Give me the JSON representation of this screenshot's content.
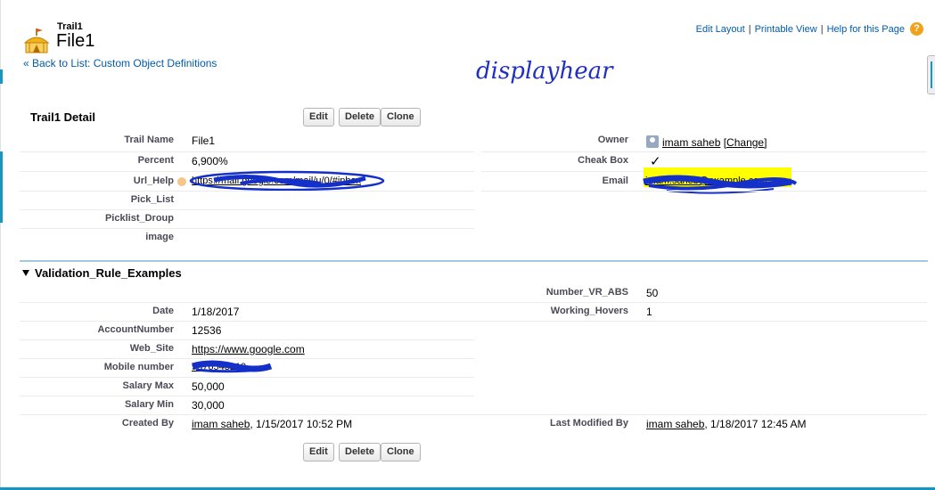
{
  "header": {
    "object_type": "Trail1",
    "record_name": "File1",
    "back_link": "« Back to List: Custom Object Definitions",
    "links": [
      "Edit Layout",
      "Printable View",
      "Help for this Page"
    ],
    "annotation": "displayhear"
  },
  "buttons": {
    "edit": "Edit",
    "delete": "Delete",
    "clone": "Clone"
  },
  "detail": {
    "title": "Trail1 Detail",
    "left": [
      {
        "label": "Trail Name",
        "value": "File1"
      },
      {
        "label": "Percent",
        "value": "6,900%"
      },
      {
        "label": "Url_Help",
        "value": "https://mail.google.com/mail/u/0/#inbox"
      },
      {
        "label": "Pick_List",
        "value": ""
      },
      {
        "label": "Picklist_Droup",
        "value": ""
      },
      {
        "label": "image",
        "value": ""
      }
    ],
    "right": [
      {
        "label": "Owner",
        "value": "imam saheb",
        "extra": "[Change]"
      },
      {
        "label": "Cheak Box",
        "value": "✓"
      },
      {
        "label": "Email",
        "value": "imam.saheb@example.com"
      }
    ]
  },
  "validation": {
    "title": "Validation_Rule_Examples",
    "right": [
      {
        "label": "Number_VR_ABS",
        "value": "50"
      },
      {
        "label": "Working_Hovers",
        "value": "1"
      }
    ],
    "left": [
      {
        "label": "Date",
        "value": "1/18/2017"
      },
      {
        "label": "AccountNumber",
        "value": "12536"
      },
      {
        "label": "Web_Site",
        "value": "https://www.google.com"
      },
      {
        "label": "Mobile number",
        "value": "9876543210"
      },
      {
        "label": "Salary Max",
        "value": "50,000"
      },
      {
        "label": "Salary Min",
        "value": "30,000"
      }
    ],
    "created_by": {
      "label": "Created By",
      "user": "imam saheb",
      "date": ", 1/15/2017 10:52 PM"
    },
    "modified_by": {
      "label": "Last Modified By",
      "user": "imam saheb",
      "date": ", 1/18/2017 12:45 AM"
    }
  },
  "colors": {
    "accent": "#1797c0",
    "link": "#015ba7",
    "redaction": "#1530c8",
    "highlight": "#ffff00"
  }
}
